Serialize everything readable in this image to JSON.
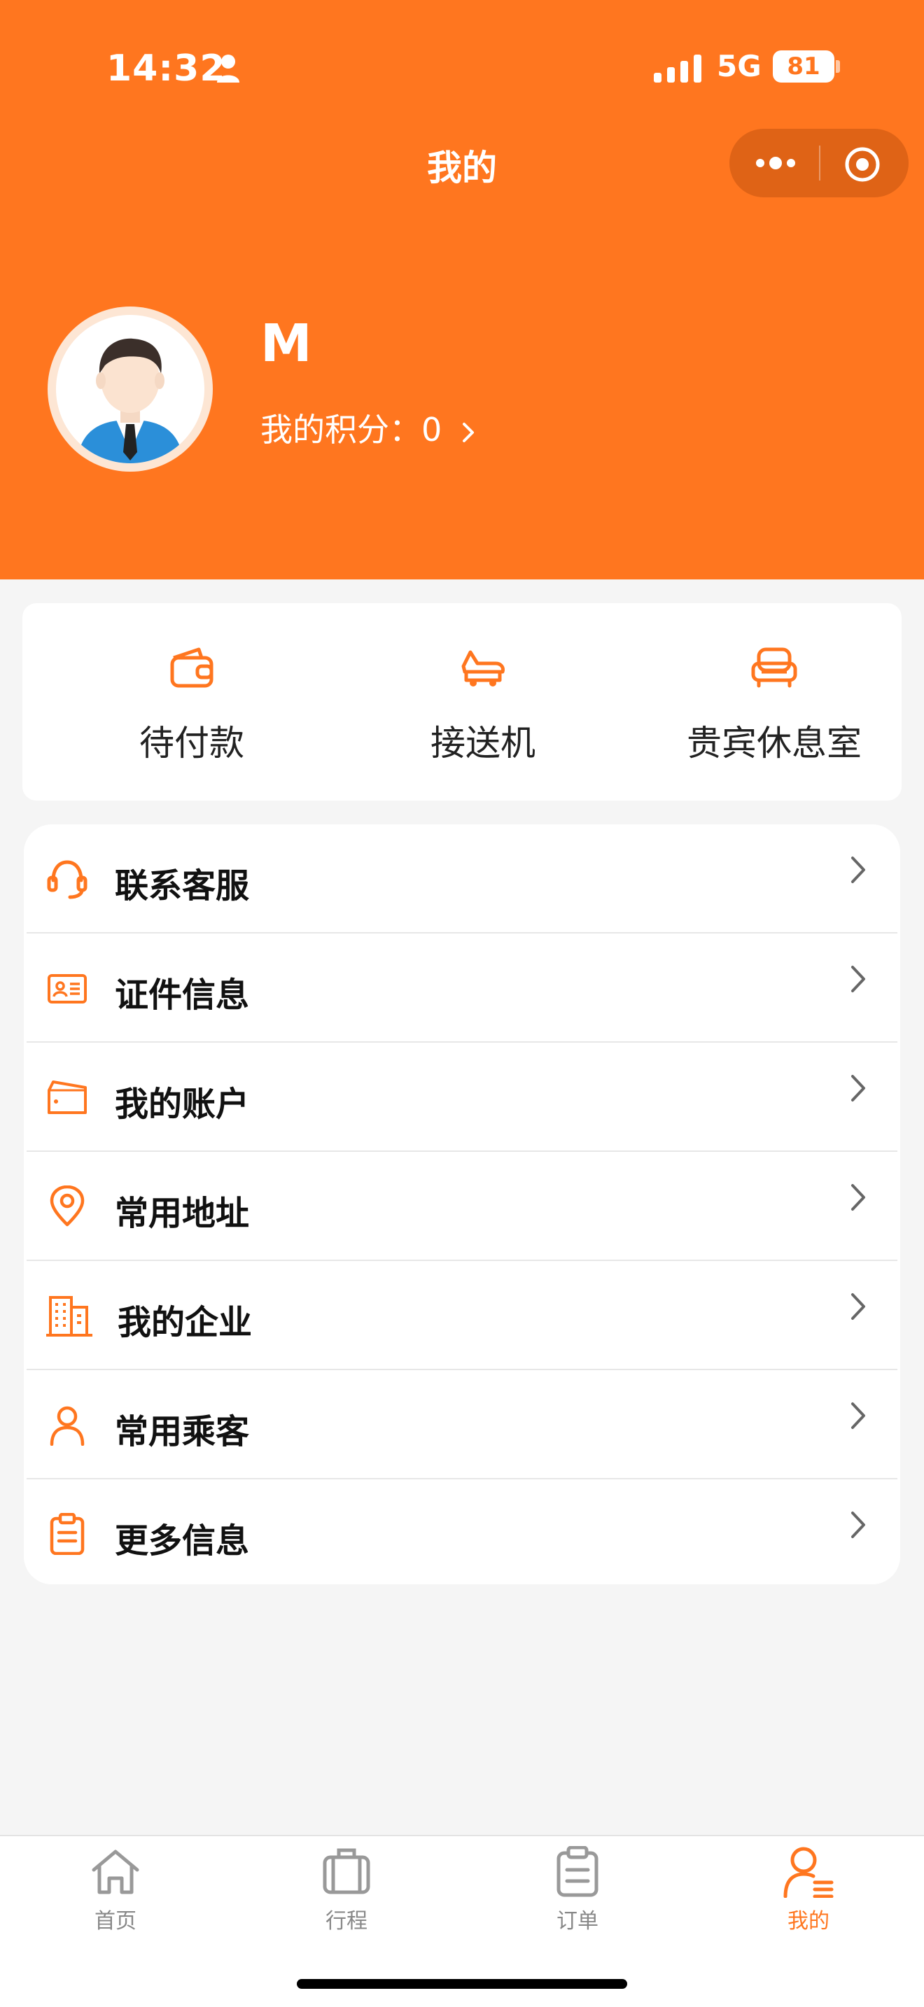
{
  "status_bar": {
    "time": "14:32",
    "network": "5G",
    "battery": "81"
  },
  "nav": {
    "title": "我的"
  },
  "profile": {
    "name": "M",
    "points_label": "我的积分：",
    "points_value": "0"
  },
  "quick_actions": [
    {
      "label": "待付款",
      "icon": "wallet-icon"
    },
    {
      "label": "接送机",
      "icon": "car-plane-icon"
    },
    {
      "label": "贵宾休息室",
      "icon": "sofa-icon"
    }
  ],
  "menu": [
    {
      "label": "联系客服",
      "icon": "headset-icon"
    },
    {
      "label": "证件信息",
      "icon": "id-card-icon"
    },
    {
      "label": "我的账户",
      "icon": "wallet-account-icon"
    },
    {
      "label": "常用地址",
      "icon": "location-pin-icon"
    },
    {
      "label": "我的企业",
      "icon": "building-icon"
    },
    {
      "label": "常用乘客",
      "icon": "person-icon"
    },
    {
      "label": "更多信息",
      "icon": "clipboard-icon"
    }
  ],
  "tabbar": [
    {
      "label": "首页",
      "icon": "home-icon"
    },
    {
      "label": "行程",
      "icon": "luggage-icon"
    },
    {
      "label": "订单",
      "icon": "clipboard-icon"
    },
    {
      "label": "我的",
      "icon": "user-list-icon",
      "active": true
    }
  ],
  "colors": {
    "accent": "#ff761f",
    "background": "#f5f5f5",
    "inactive": "#888888"
  }
}
